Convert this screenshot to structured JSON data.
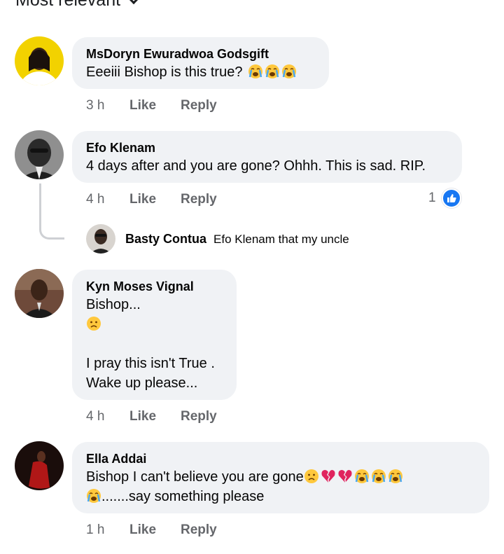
{
  "header": {
    "sort_label": "Most relevant"
  },
  "comments": [
    {
      "author": "MsDoryn Ewuradwoa Godsgift",
      "text": "Eeeiii Bishop is this true?",
      "time": "3 h",
      "like": "Like",
      "reply": "Reply"
    },
    {
      "author": "Efo Klenam",
      "text": "4 days after and you are gone? Ohhh. This is sad. RIP.",
      "time": "4 h",
      "like": "Like",
      "reply": "Reply",
      "reaction_count": "1",
      "reply_preview": {
        "author": "Basty Contua",
        "text": "Efo Klenam that my uncle"
      }
    },
    {
      "author": "Kyn Moses Vignal",
      "lines": [
        "Bishop...",
        "",
        "I pray this isn't True .",
        "Wake up please..."
      ],
      "time": "4 h",
      "like": "Like",
      "reply": "Reply"
    },
    {
      "author": "Ella Addai",
      "line1": "Bishop I can't believe you are gone",
      "line2": ".......say something please",
      "time": "1 h",
      "like": "Like",
      "reply": "Reply"
    }
  ],
  "colors": {
    "bubble": "#f0f2f5",
    "meta": "#65676b",
    "like_blue": "#1877f2"
  }
}
